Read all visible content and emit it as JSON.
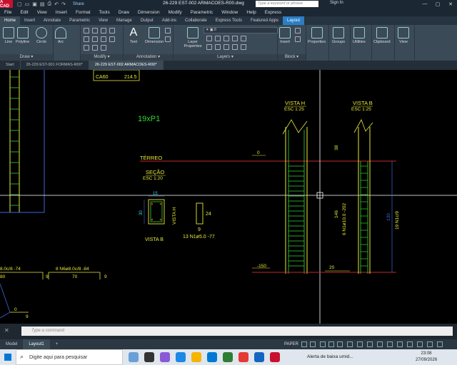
{
  "titlebar": {
    "app_logo": "A CAD",
    "share_label": "Share",
    "doc_title": "26-229 EST-002 ARMACOES-R00.dwg",
    "search_placeholder": "Type a keyword or phrase",
    "signin_label": "Sign In"
  },
  "menubar": [
    "File",
    "Edit",
    "View",
    "Insert",
    "Format",
    "Tools",
    "Draw",
    "Dimension",
    "Modify",
    "Parametric",
    "Window",
    "Help",
    "Express"
  ],
  "ribbon_tabs": [
    {
      "label": "Home",
      "state": "active"
    },
    {
      "label": "Insert",
      "state": ""
    },
    {
      "label": "Annotate",
      "state": ""
    },
    {
      "label": "Parametric",
      "state": ""
    },
    {
      "label": "View",
      "state": ""
    },
    {
      "label": "Manage",
      "state": ""
    },
    {
      "label": "Output",
      "state": ""
    },
    {
      "label": "Add-ins",
      "state": ""
    },
    {
      "label": "Collaborate",
      "state": ""
    },
    {
      "label": "Express Tools",
      "state": ""
    },
    {
      "label": "Featured Apps",
      "state": ""
    },
    {
      "label": "Layout",
      "state": "highlighted"
    }
  ],
  "ribbon": {
    "tools": {
      "line": "Line",
      "polyline": "Polyline",
      "circle": "Circle",
      "arc": "Arc",
      "text": "Text",
      "dimension": "Dimension",
      "layer_properties": "Layer Properties",
      "insert": "Insert",
      "properties": "Properties",
      "groups": "Groups",
      "utilities": "Utilities",
      "clipboard": "Clipboard",
      "view": "View"
    },
    "panels": {
      "draw": "Draw ▾",
      "modify": "Modify ▾",
      "annotation": "Annotation ▾",
      "layers": "Layers ▾",
      "block": "Block ▾"
    }
  },
  "doc_tabs": [
    {
      "label": "Start",
      "active": false
    },
    {
      "label": "26-229 EST-001 FORMAS-R00*",
      "active": false
    },
    {
      "label": "26-229 EST-002 ARMACOES-R00*",
      "active": true
    }
  ],
  "drawing": {
    "table_ca60": "CA60",
    "table_ca60_val": "214.5",
    "label_19xp1": "19xP1",
    "terreo": "TÉRREO",
    "secao": "SEÇÃO",
    "esc_120": "ESC 1:20",
    "vista_h": "VISTA H",
    "vista_b": "VISTA B",
    "esc_125a": "ESC 1:25",
    "esc_125b": "ESC 1:25",
    "vista_h_small": "VISTA H",
    "vista_b_small": "VISTA B",
    "dim_15": "15",
    "dim_30": "30",
    "dim_24": "24",
    "dim_9": "9",
    "stirrup_label": "13 N1ø5.0 -77",
    "level_0": "0",
    "level_neg150": "-150",
    "dim_38": "38",
    "dim_146": "146",
    "bar_6n1": "6 N1ø10.0 -202",
    "dim_20": "20",
    "dim_130": "130",
    "bar_19n1": "19 N1c/9",
    "bottom_left_a": "8.0c/8 -74",
    "bottom_left_b": "80",
    "bottom_mid_a": "8 N6ø8.0c/8 -84",
    "bottom_mid_b": "70",
    "bottom_9a": "9",
    "bottom_9b": "9",
    "bottom_9c": "9",
    "bottom_0": "0"
  },
  "command_placeholder": "Type a command",
  "layout_tabs": [
    {
      "label": "Model",
      "active": false
    },
    {
      "label": "Layout1",
      "active": true
    },
    {
      "label": "+",
      "active": false
    }
  ],
  "status": {
    "paper": "PAPER"
  },
  "taskbar": {
    "search_placeholder": "Digite aqui para pesquisar",
    "alert": "Alerta de baixa umid...",
    "time": "23:08",
    "date": "27/09/2026"
  },
  "colors": {
    "yellow": "#e8e83a",
    "green": "#33d633",
    "red": "#c62828",
    "blue": "#3a68d8",
    "cyan": "#39d6d6",
    "white": "#ffffff"
  }
}
